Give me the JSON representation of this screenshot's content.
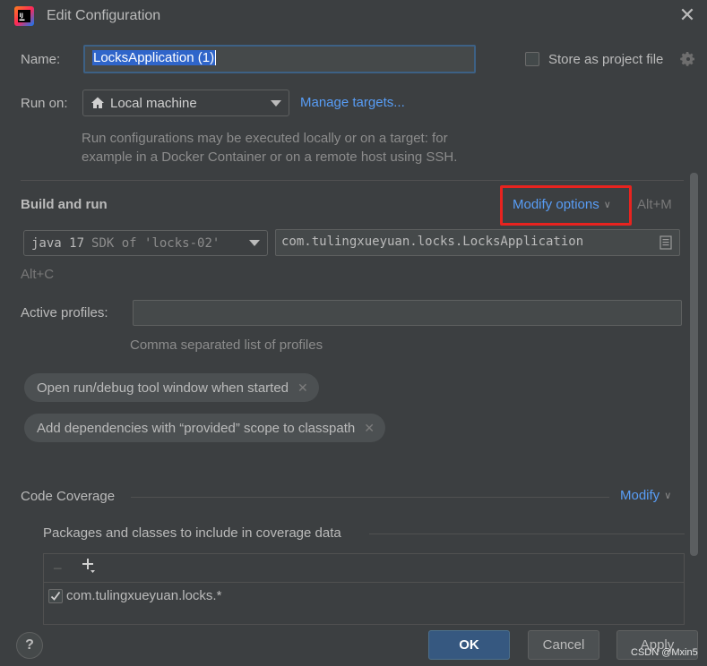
{
  "window": {
    "title": "Edit Configuration",
    "close_glyph": "✕"
  },
  "name": {
    "label": "Name:",
    "value": "LocksApplication (1)"
  },
  "store": {
    "label": "Store as project file",
    "checked": false
  },
  "run_on": {
    "label": "Run on:",
    "selected": "Local machine",
    "manage_link": "Manage targets...",
    "hint_line1": "Run configurations may be executed locally or on a target: for",
    "hint_line2": "example in a Docker Container or on a remote host using SSH."
  },
  "build": {
    "section_title": "Build and run",
    "modify_options": "Modify options",
    "modify_shortcut": "Alt+M",
    "jdk_version": "java 17",
    "jdk_sdk": "SDK of 'locks-02'",
    "main_class": "com.tulingxueyuan.locks.LocksApplication",
    "alt_c": "Alt+C"
  },
  "profiles": {
    "label": "Active profiles:",
    "value": "",
    "hint": "Comma separated list of profiles"
  },
  "chips": [
    {
      "label": "Open run/debug tool window when started"
    },
    {
      "label": "Add dependencies with “provided” scope to classpath"
    }
  ],
  "coverage": {
    "title": "Code Coverage",
    "modify": "Modify",
    "packages_label": "Packages and classes to include in coverage data",
    "items": [
      {
        "label": "com.tulingxueyuan.locks.*",
        "checked": true
      }
    ]
  },
  "buttons": {
    "help": "?",
    "ok": "OK",
    "cancel": "Cancel",
    "apply": "Apply"
  },
  "watermark": "CSDN @Mxin5",
  "colors": {
    "background": "#3c3f41",
    "link": "#589df6",
    "highlight_box": "#e8231f",
    "primary_button": "#365880",
    "selection": "#2f65ca"
  }
}
